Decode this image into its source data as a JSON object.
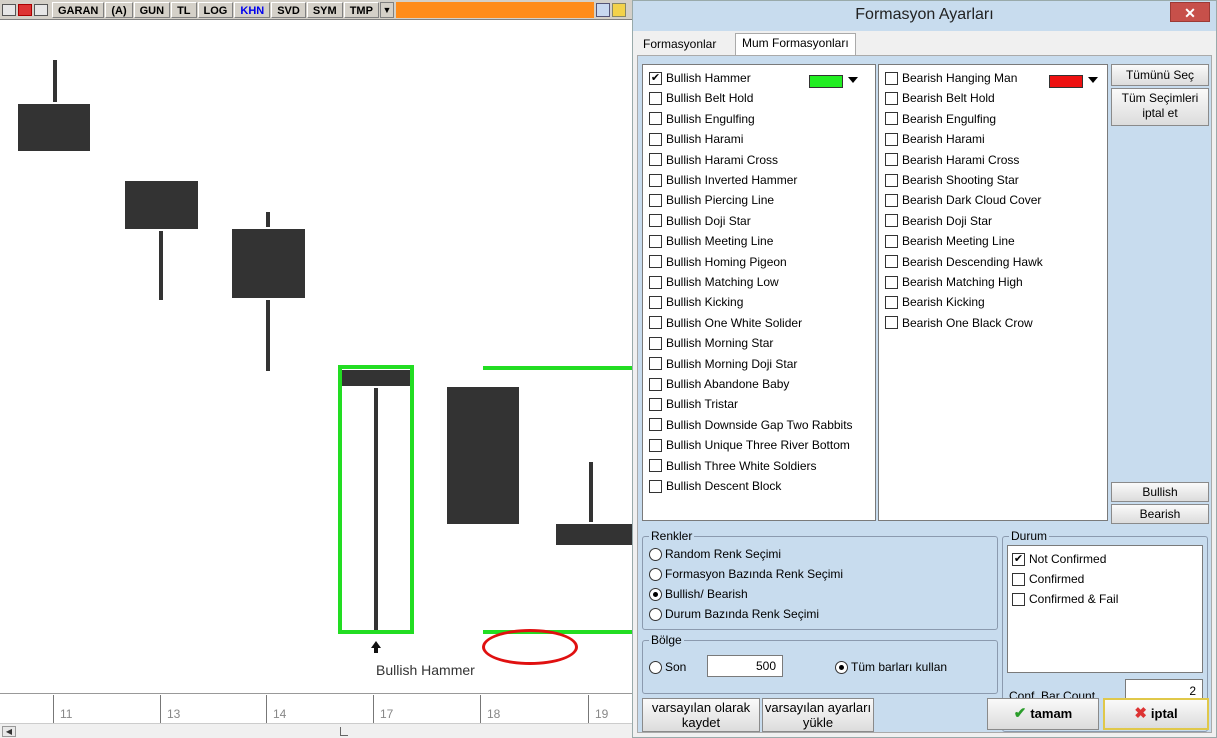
{
  "toolbar": {
    "symbol": "GARAN",
    "items": [
      "(A)",
      "GUN",
      "TL",
      "LOG",
      "KHN",
      "SVD",
      "SYM",
      "TMP"
    ],
    "active_item": "KHN",
    "dropdown_icon": "chevron-down-icon",
    "bar_color": "#ff8c1a"
  },
  "chart": {
    "pattern_label": "Bullish Hammer",
    "x_ticks": [
      "11",
      "13",
      "14",
      "17",
      "18",
      "19"
    ],
    "highlight_color": "#22dd22",
    "candle_color": "#333333",
    "marker_icon": "up-arrow-icon"
  },
  "dialog": {
    "title": "Formasyon Ayarları",
    "close_icon": "close-icon",
    "tabs": [
      "Formasyonlar",
      "Mum Formasyonları"
    ],
    "active_tab": "Mum Formasyonları",
    "bullish_patterns": [
      {
        "label": "Bullish Hammer",
        "checked": true
      },
      {
        "label": "Bullish Belt Hold",
        "checked": false
      },
      {
        "label": "Bullish Engulfing",
        "checked": false
      },
      {
        "label": "Bullish Harami",
        "checked": false
      },
      {
        "label": "Bullish Harami Cross",
        "checked": false
      },
      {
        "label": "Bullish Inverted Hammer",
        "checked": false
      },
      {
        "label": "Bullish Piercing Line",
        "checked": false
      },
      {
        "label": "Bullish Doji Star",
        "checked": false
      },
      {
        "label": "Bullish Meeting Line",
        "checked": false
      },
      {
        "label": "Bullish Homing Pigeon",
        "checked": false
      },
      {
        "label": "Bullish Matching Low",
        "checked": false
      },
      {
        "label": "Bullish Kicking",
        "checked": false
      },
      {
        "label": "Bullish One White Solider",
        "checked": false
      },
      {
        "label": "Bullish Morning Star",
        "checked": false
      },
      {
        "label": "Bullish Morning Doji Star",
        "checked": false
      },
      {
        "label": "Bullish Abandone Baby",
        "checked": false
      },
      {
        "label": "Bullish Tristar",
        "checked": false
      },
      {
        "label": "Bullish Downside Gap Two Rabbits",
        "checked": false
      },
      {
        "label": "Bullish Unique Three River Bottom",
        "checked": false
      },
      {
        "label": "Bullish Three White Soldiers",
        "checked": false
      },
      {
        "label": "Bullish Descent Block",
        "checked": false
      }
    ],
    "bearish_patterns": [
      {
        "label": "Bearish Hanging Man",
        "checked": false
      },
      {
        "label": "Bearish Belt Hold",
        "checked": false
      },
      {
        "label": "Bearish Engulfing",
        "checked": false
      },
      {
        "label": "Bearish Harami",
        "checked": false
      },
      {
        "label": "Bearish Harami Cross",
        "checked": false
      },
      {
        "label": "Bearish Shooting Star",
        "checked": false
      },
      {
        "label": "Bearish Dark Cloud Cover",
        "checked": false
      },
      {
        "label": "Bearish Doji Star",
        "checked": false
      },
      {
        "label": "Bearish Meeting Line",
        "checked": false
      },
      {
        "label": "Bearish Descending Hawk",
        "checked": false
      },
      {
        "label": "Bearish Matching High",
        "checked": false
      },
      {
        "label": "Bearish Kicking",
        "checked": false
      },
      {
        "label": "Bearish One Black Crow",
        "checked": false
      }
    ],
    "bullish_color": "#22ee22",
    "bearish_color": "#ee1111",
    "buttons": {
      "select_all": "Tümünü Seç",
      "deselect_all": "Tüm Seçimleri iptal et",
      "bullish": "Bullish",
      "bearish": "Bearish",
      "save_defaults": "varsayılan olarak kaydet",
      "load_defaults": "varsayılan ayarları yükle",
      "ok": "tamam",
      "cancel": "iptal"
    },
    "renkler": {
      "title": "Renkler",
      "options": [
        {
          "label": "Random Renk Seçimi",
          "selected": false
        },
        {
          "label": "Formasyon Bazında Renk Seçimi",
          "selected": false
        },
        {
          "label": "Bullish/ Bearish",
          "selected": true
        },
        {
          "label": "Durum Bazında Renk Seçimi",
          "selected": false
        }
      ]
    },
    "bolge": {
      "title": "Bölge",
      "son_label": "Son",
      "son_value": "500",
      "use_all_label": "Tüm barları kullan",
      "son_selected": false,
      "use_all_selected": true
    },
    "durum": {
      "title": "Durum",
      "options": [
        {
          "label": "Not Confirmed",
          "checked": true
        },
        {
          "label": "Confirmed",
          "checked": false
        },
        {
          "label": "Confirmed & Fail",
          "checked": false
        }
      ],
      "conf_bar_label": "Conf. Bar Count",
      "conf_bar_value": "2"
    }
  }
}
